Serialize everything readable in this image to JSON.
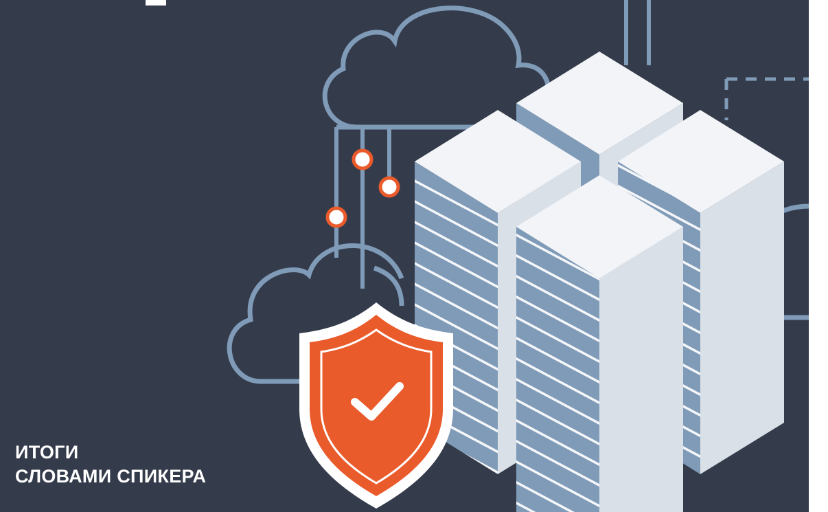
{
  "caption": {
    "line1": "ИТОГИ",
    "line2": "СЛОВАМИ СПИКЕРА"
  },
  "colors": {
    "background": "#343b4b",
    "line": "#7f9bb8",
    "server_top": "#f2f4f7",
    "server_side_light": "#d6dde6",
    "server_side_dark": "#7f9bb8",
    "accent": "#ea5b2b",
    "text": "#ffffff"
  },
  "icons": [
    "cloud-icon",
    "server-rack-icon",
    "shield-check-icon",
    "network-node-icon"
  ]
}
